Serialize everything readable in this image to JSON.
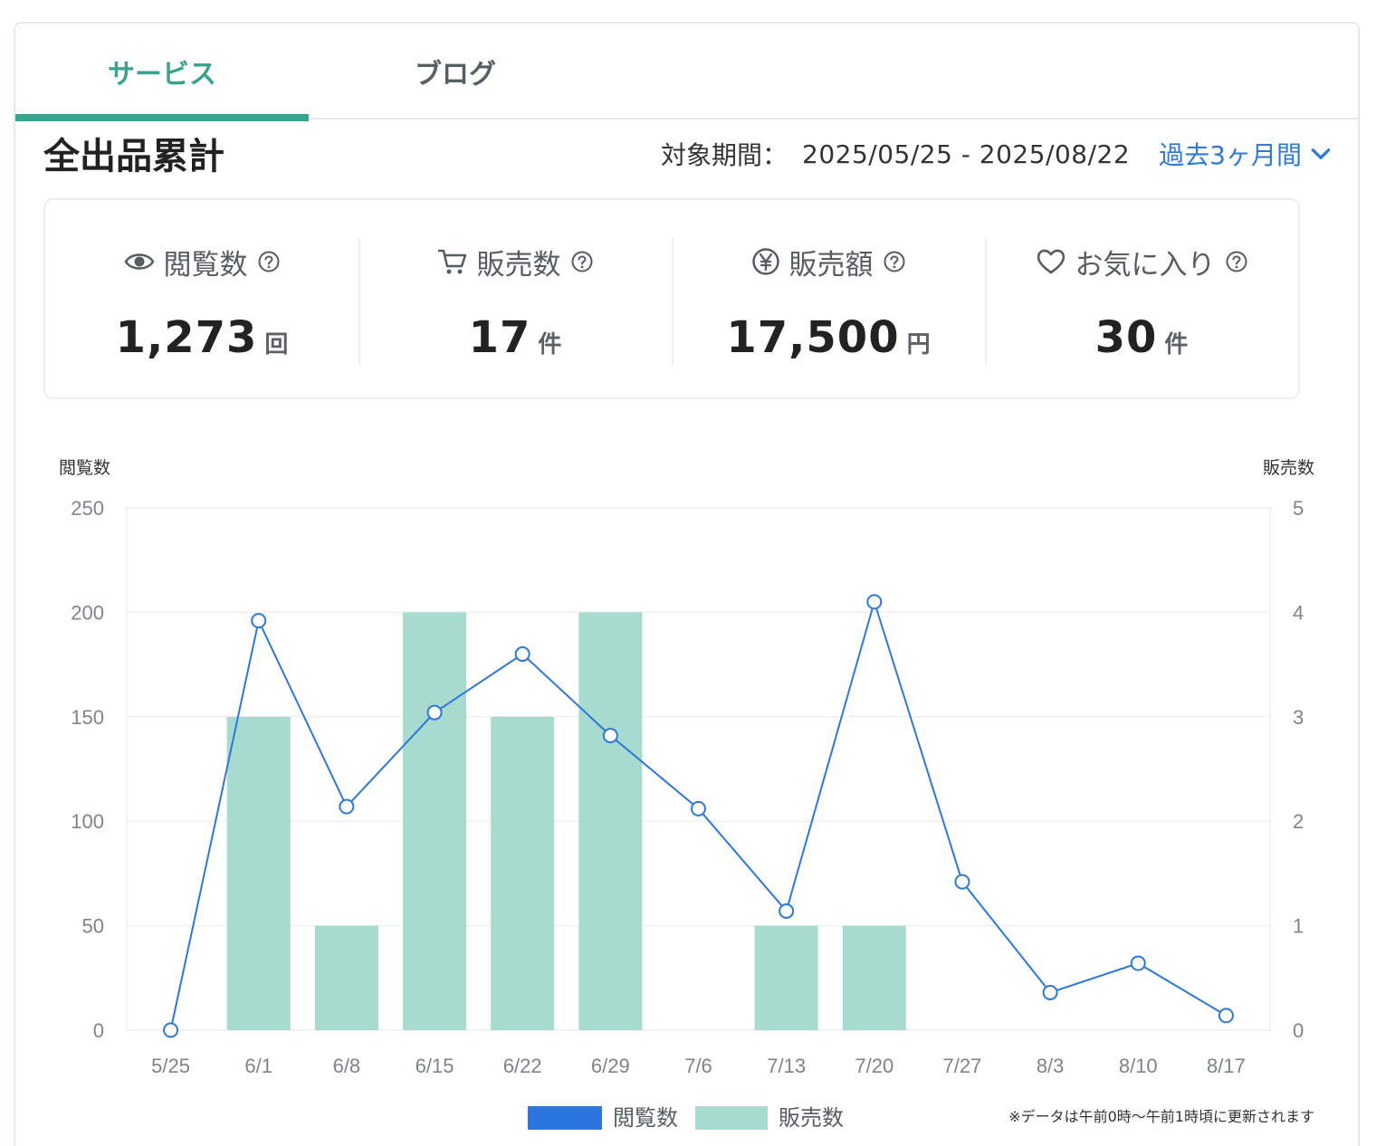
{
  "tabs": [
    {
      "label": "サービス",
      "active": true
    },
    {
      "label": "ブログ",
      "active": false
    }
  ],
  "section_title": "全出品累計",
  "period": {
    "label": "対象期間：",
    "range": "2025/05/25 - 2025/08/22",
    "select": "過去3ヶ月間"
  },
  "stats": [
    {
      "icon": "eye-icon",
      "label": "閲覧数",
      "value": "1,273",
      "unit": "回"
    },
    {
      "icon": "cart-icon",
      "label": "販売数",
      "value": "17",
      "unit": "件"
    },
    {
      "icon": "yen-icon",
      "label": "販売額",
      "value": "17,500",
      "unit": "円"
    },
    {
      "icon": "heart-icon",
      "label": "お気に入り",
      "value": "30",
      "unit": "件"
    }
  ],
  "colors": {
    "accent": "#3aa38d",
    "link": "#2f7ad9",
    "line": "#2e78d8",
    "bar": "#a7dbcf",
    "legend_line": "#2a76de"
  },
  "chart_data": {
    "type": "bar+line",
    "categories": [
      "5/25",
      "6/1",
      "6/8",
      "6/15",
      "6/22",
      "6/29",
      "7/6",
      "7/13",
      "7/20",
      "7/27",
      "8/3",
      "8/10",
      "8/17"
    ],
    "series": [
      {
        "name": "閲覧数",
        "type": "line",
        "axis": "left",
        "values": [
          0,
          196,
          107,
          152,
          180,
          141,
          106,
          57,
          205,
          71,
          18,
          32,
          7
        ]
      },
      {
        "name": "販売数",
        "type": "bar",
        "axis": "right",
        "values": [
          0,
          3,
          1,
          4,
          3,
          4,
          0,
          1,
          1,
          0,
          0,
          0,
          0
        ]
      }
    ],
    "ylabel_left": "閲覧数",
    "ylabel_right": "販売数",
    "ylim_left": [
      0,
      250
    ],
    "yticks_left": [
      0,
      50,
      100,
      150,
      200,
      250
    ],
    "ylim_right": [
      0,
      5
    ],
    "yticks_right": [
      0,
      1,
      2,
      3,
      4,
      5
    ],
    "grid": true,
    "legend": "bottom-center"
  },
  "footnote": "※データは午前0時〜午前1時頃に更新されます"
}
